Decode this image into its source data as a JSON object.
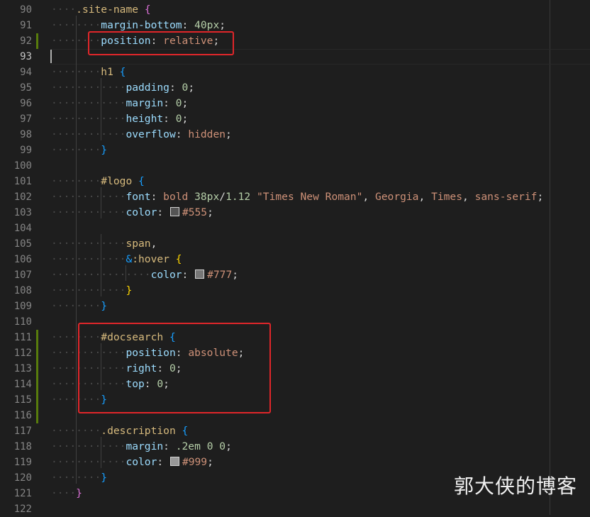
{
  "editor": {
    "lines": [
      {
        "num": "90",
        "tokens": [
          {
            "t": "ws",
            "v": "····"
          },
          {
            "t": "sel",
            "v": ".site-name"
          },
          {
            "t": "punc",
            "v": " "
          },
          {
            "t": "brace-p",
            "v": "{"
          }
        ]
      },
      {
        "num": "91",
        "tokens": [
          {
            "t": "ws",
            "v": "········"
          },
          {
            "t": "prop",
            "v": "margin-bottom"
          },
          {
            "t": "punc",
            "v": ": "
          },
          {
            "t": "num",
            "v": "40px"
          },
          {
            "t": "punc",
            "v": ";"
          }
        ]
      },
      {
        "num": "92",
        "modified": true,
        "tokens": [
          {
            "t": "ws",
            "v": "········"
          },
          {
            "t": "prop",
            "v": "position"
          },
          {
            "t": "punc",
            "v": ": "
          },
          {
            "t": "val",
            "v": "relative"
          },
          {
            "t": "punc",
            "v": ";"
          }
        ]
      },
      {
        "num": "93",
        "current": true,
        "tokens": []
      },
      {
        "num": "94",
        "tokens": [
          {
            "t": "ws",
            "v": "········"
          },
          {
            "t": "sel",
            "v": "h1"
          },
          {
            "t": "punc",
            "v": " "
          },
          {
            "t": "brace-b",
            "v": "{"
          }
        ]
      },
      {
        "num": "95",
        "tokens": [
          {
            "t": "ws",
            "v": "············"
          },
          {
            "t": "prop",
            "v": "padding"
          },
          {
            "t": "punc",
            "v": ": "
          },
          {
            "t": "num",
            "v": "0"
          },
          {
            "t": "punc",
            "v": ";"
          }
        ]
      },
      {
        "num": "96",
        "tokens": [
          {
            "t": "ws",
            "v": "············"
          },
          {
            "t": "prop",
            "v": "margin"
          },
          {
            "t": "punc",
            "v": ": "
          },
          {
            "t": "num",
            "v": "0"
          },
          {
            "t": "punc",
            "v": ";"
          }
        ]
      },
      {
        "num": "97",
        "tokens": [
          {
            "t": "ws",
            "v": "············"
          },
          {
            "t": "prop",
            "v": "height"
          },
          {
            "t": "punc",
            "v": ": "
          },
          {
            "t": "num",
            "v": "0"
          },
          {
            "t": "punc",
            "v": ";"
          }
        ]
      },
      {
        "num": "98",
        "tokens": [
          {
            "t": "ws",
            "v": "············"
          },
          {
            "t": "prop",
            "v": "overflow"
          },
          {
            "t": "punc",
            "v": ": "
          },
          {
            "t": "val",
            "v": "hidden"
          },
          {
            "t": "punc",
            "v": ";"
          }
        ]
      },
      {
        "num": "99",
        "tokens": [
          {
            "t": "ws",
            "v": "········"
          },
          {
            "t": "brace-b",
            "v": "}"
          }
        ]
      },
      {
        "num": "100",
        "tokens": []
      },
      {
        "num": "101",
        "tokens": [
          {
            "t": "ws",
            "v": "········"
          },
          {
            "t": "sel",
            "v": "#logo"
          },
          {
            "t": "punc",
            "v": " "
          },
          {
            "t": "brace-b",
            "v": "{"
          }
        ]
      },
      {
        "num": "102",
        "tokens": [
          {
            "t": "ws",
            "v": "············"
          },
          {
            "t": "prop",
            "v": "font"
          },
          {
            "t": "punc",
            "v": ": "
          },
          {
            "t": "val",
            "v": "bold "
          },
          {
            "t": "num",
            "v": "38px"
          },
          {
            "t": "punc",
            "v": "/"
          },
          {
            "t": "num",
            "v": "1.12"
          },
          {
            "t": "punc",
            "v": " "
          },
          {
            "t": "val",
            "v": "\"Times New Roman\""
          },
          {
            "t": "punc",
            "v": ", "
          },
          {
            "t": "val",
            "v": "Georgia"
          },
          {
            "t": "punc",
            "v": ", "
          },
          {
            "t": "val",
            "v": "Times"
          },
          {
            "t": "punc",
            "v": ", "
          },
          {
            "t": "val",
            "v": "sans-serif"
          },
          {
            "t": "punc",
            "v": ";"
          }
        ]
      },
      {
        "num": "103",
        "tokens": [
          {
            "t": "ws",
            "v": "············"
          },
          {
            "t": "prop",
            "v": "color"
          },
          {
            "t": "punc",
            "v": ": "
          },
          {
            "t": "swatch",
            "v": "#555555"
          },
          {
            "t": "val",
            "v": "#555"
          },
          {
            "t": "punc",
            "v": ";"
          }
        ]
      },
      {
        "num": "104",
        "tokens": []
      },
      {
        "num": "105",
        "tokens": [
          {
            "t": "ws",
            "v": "············"
          },
          {
            "t": "sel",
            "v": "span"
          },
          {
            "t": "punc",
            "v": ","
          }
        ]
      },
      {
        "num": "106",
        "tokens": [
          {
            "t": "ws",
            "v": "············"
          },
          {
            "t": "brace-b",
            "v": "&"
          },
          {
            "t": "sel",
            "v": ":hover"
          },
          {
            "t": "punc",
            "v": " "
          },
          {
            "t": "brace-y",
            "v": "{"
          }
        ]
      },
      {
        "num": "107",
        "tokens": [
          {
            "t": "ws",
            "v": "················"
          },
          {
            "t": "prop",
            "v": "color"
          },
          {
            "t": "punc",
            "v": ": "
          },
          {
            "t": "swatch",
            "v": "#777777"
          },
          {
            "t": "val",
            "v": "#777"
          },
          {
            "t": "punc",
            "v": ";"
          }
        ]
      },
      {
        "num": "108",
        "tokens": [
          {
            "t": "ws",
            "v": "············"
          },
          {
            "t": "brace-y",
            "v": "}"
          }
        ]
      },
      {
        "num": "109",
        "tokens": [
          {
            "t": "ws",
            "v": "········"
          },
          {
            "t": "brace-b",
            "v": "}"
          }
        ]
      },
      {
        "num": "110",
        "tokens": []
      },
      {
        "num": "111",
        "modified": true,
        "tokens": [
          {
            "t": "ws",
            "v": "········"
          },
          {
            "t": "sel",
            "v": "#docsearch"
          },
          {
            "t": "punc",
            "v": " "
          },
          {
            "t": "brace-b",
            "v": "{"
          }
        ]
      },
      {
        "num": "112",
        "modified": true,
        "tokens": [
          {
            "t": "ws",
            "v": "············"
          },
          {
            "t": "prop",
            "v": "position"
          },
          {
            "t": "punc",
            "v": ": "
          },
          {
            "t": "val",
            "v": "absolute"
          },
          {
            "t": "punc",
            "v": ";"
          }
        ]
      },
      {
        "num": "113",
        "modified": true,
        "tokens": [
          {
            "t": "ws",
            "v": "············"
          },
          {
            "t": "prop",
            "v": "right"
          },
          {
            "t": "punc",
            "v": ": "
          },
          {
            "t": "num",
            "v": "0"
          },
          {
            "t": "punc",
            "v": ";"
          }
        ]
      },
      {
        "num": "114",
        "modified": true,
        "tokens": [
          {
            "t": "ws",
            "v": "············"
          },
          {
            "t": "prop",
            "v": "top"
          },
          {
            "t": "punc",
            "v": ": "
          },
          {
            "t": "num",
            "v": "0"
          },
          {
            "t": "punc",
            "v": ";"
          }
        ]
      },
      {
        "num": "115",
        "modified": true,
        "tokens": [
          {
            "t": "ws",
            "v": "········"
          },
          {
            "t": "brace-b",
            "v": "}"
          }
        ]
      },
      {
        "num": "116",
        "modified": true,
        "tokens": []
      },
      {
        "num": "117",
        "tokens": [
          {
            "t": "ws",
            "v": "········"
          },
          {
            "t": "sel",
            "v": ".description"
          },
          {
            "t": "punc",
            "v": " "
          },
          {
            "t": "brace-b",
            "v": "{"
          }
        ]
      },
      {
        "num": "118",
        "tokens": [
          {
            "t": "ws",
            "v": "············"
          },
          {
            "t": "prop",
            "v": "margin"
          },
          {
            "t": "punc",
            "v": ": "
          },
          {
            "t": "num",
            "v": ".2em"
          },
          {
            "t": "punc",
            "v": " "
          },
          {
            "t": "num",
            "v": "0"
          },
          {
            "t": "punc",
            "v": " "
          },
          {
            "t": "num",
            "v": "0"
          },
          {
            "t": "punc",
            "v": ";"
          }
        ]
      },
      {
        "num": "119",
        "tokens": [
          {
            "t": "ws",
            "v": "············"
          },
          {
            "t": "prop",
            "v": "color"
          },
          {
            "t": "punc",
            "v": ": "
          },
          {
            "t": "swatch",
            "v": "#999999"
          },
          {
            "t": "val",
            "v": "#999"
          },
          {
            "t": "punc",
            "v": ";"
          }
        ]
      },
      {
        "num": "120",
        "tokens": [
          {
            "t": "ws",
            "v": "········"
          },
          {
            "t": "brace-b",
            "v": "}"
          }
        ]
      },
      {
        "num": "121",
        "tokens": [
          {
            "t": "ws",
            "v": "····"
          },
          {
            "t": "brace-p",
            "v": "}"
          }
        ]
      },
      {
        "num": "122",
        "tokens": []
      }
    ]
  },
  "watermark": "郭大侠的博客"
}
